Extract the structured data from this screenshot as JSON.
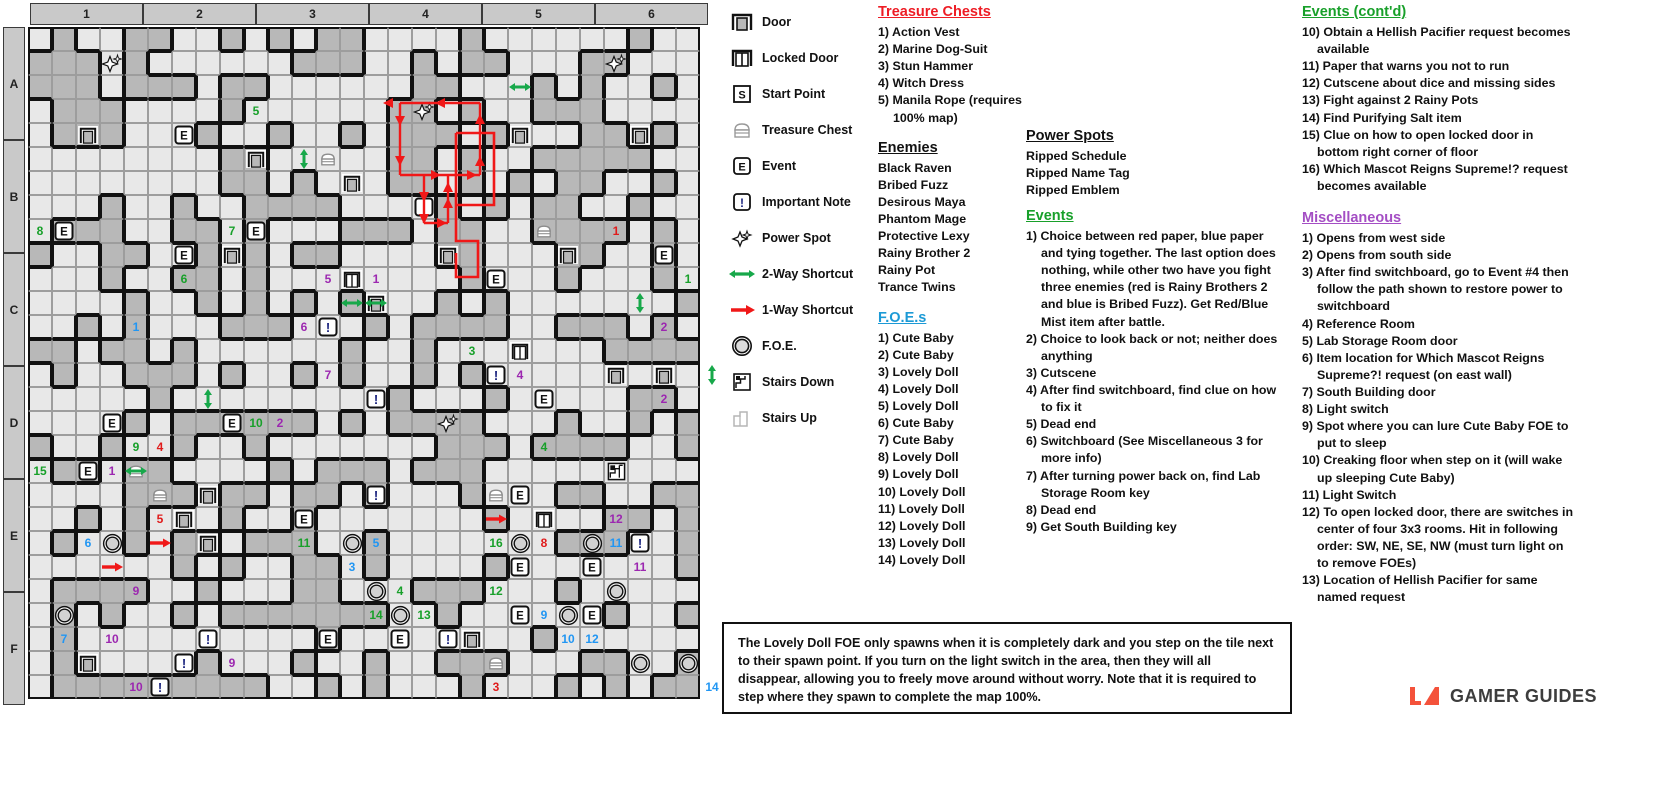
{
  "map": {
    "column_headers": [
      "1",
      "2",
      "3",
      "4",
      "5",
      "6"
    ],
    "row_headers": [
      "A",
      "B",
      "C",
      "D",
      "E",
      "F"
    ]
  },
  "legend": {
    "items": [
      {
        "icon": "door-icon",
        "label": "Door"
      },
      {
        "icon": "locked-door-icon",
        "label": "Locked Door"
      },
      {
        "icon": "start-point-icon",
        "label": "Start Point"
      },
      {
        "icon": "treasure-chest-icon",
        "label": "Treasure Chest"
      },
      {
        "icon": "event-icon",
        "label": "Event"
      },
      {
        "icon": "important-note-icon",
        "label": "Important Note"
      },
      {
        "icon": "power-spot-icon",
        "label": "Power Spot"
      },
      {
        "icon": "two-way-shortcut-icon",
        "label": "2-Way Shortcut"
      },
      {
        "icon": "one-way-shortcut-icon",
        "label": "1-Way Shortcut"
      },
      {
        "icon": "foe-icon",
        "label": "F.O.E."
      },
      {
        "icon": "stairs-down-icon",
        "label": "Stairs Down"
      },
      {
        "icon": "stairs-up-icon",
        "label": "Stairs Up"
      }
    ]
  },
  "treasure_chests": {
    "title": "Treasure Chests",
    "color": "#ee1c24",
    "items": [
      "1) Action Vest",
      "2) Marine Dog-Suit",
      "3) Stun Hammer",
      "4) Witch Dress",
      "5) Manila Rope (requires 100% map)"
    ]
  },
  "enemies": {
    "title": "Enemies",
    "color": "#111111",
    "items": [
      "Black Raven",
      "Bribed Fuzz",
      "Desirous Maya",
      "Phantom Mage",
      "Protective Lexy",
      "Rainy Brother 2",
      "Rainy Pot",
      "Trance Twins"
    ]
  },
  "foes": {
    "title": "F.O.E.s",
    "color": "#1c9ad6",
    "items": [
      "1) Cute Baby",
      "2) Cute Baby",
      "3) Lovely Doll",
      "4) Lovely Doll",
      "5) Lovely Doll",
      "6) Cute Baby",
      "7) Cute Baby",
      "8) Lovely Doll",
      "9) Lovely Doll",
      "10) Lovely Doll",
      "11) Lovely Doll",
      "12) Lovely Doll",
      "13) Lovely Doll",
      "14) Lovely Doll"
    ]
  },
  "power_spots": {
    "title": "Power Spots",
    "color": "#111111",
    "items": [
      "Ripped Schedule",
      "Ripped Name Tag",
      "Ripped Emblem"
    ]
  },
  "events": {
    "title": "Events",
    "color": "#18a02a",
    "items": [
      "1) Choice between red paper, blue paper and tying together. The last option does nothing, while other two have you fight three enemies (red is Rainy Brothers 2 and blue is Bribed Fuzz). Get Red/Blue Mist item after battle.",
      "2) Choice to look back or not; neither does anything",
      "3) Cutscene",
      "4) After find switchboard, find clue on how to fix it",
      "5) Dead end",
      "6) Switchboard (See Miscellaneous 3 for more info)",
      "7) After turning power back on, find Lab Storage Room key",
      "8) Dead end",
      "9) Get South Building key"
    ]
  },
  "events_cont": {
    "title": "Events (cont'd)",
    "color": "#18a02a",
    "items": [
      "10) Obtain a Hellish Pacifier request becomes available",
      "11) Paper that warns you not to run",
      "12) Cutscene about dice and missing sides",
      "13) Fight against 2 Rainy Pots",
      "14) Find Purifying Salt item",
      "15) Clue on how to open locked door in bottom right corner of floor",
      "16) Which Mascot Reigns Supreme!? request becomes available"
    ]
  },
  "miscellaneous": {
    "title": "Miscellaneous",
    "color": "#a44ec4",
    "items": [
      "1) Opens from west side",
      "2) Opens from south side",
      "3) After find switchboard, go to Event #4 then follow the path shown to restore power to switchboard",
      "4) Reference Room",
      "5) Lab Storage Room door",
      "6) Item location for Which Mascot Reigns Supreme?! request (on east wall)",
      "7) South Building door",
      "8) Light switch",
      "9) Spot where you can lure Cute Baby FOE to put to sleep",
      "10) Creaking floor when step on it (will wake up sleeping Cute Baby)",
      "11) Light Switch",
      "12) To open locked door, there are switches in center of four 3x3 rooms. Hit in following order: SW, NE, SE, NW (must turn light on to remove FOEs)",
      "13) Location of Hellish Pacifier for same named request"
    ]
  },
  "note": {
    "text": "The Lovely Doll FOE only spawns when it is completely dark and you step on the tile next to their spawn point. If you turn on the light switch in the area, then they will all disappear, allowing you to freely move around without worry. Note that it is required to step where they spawn to complete the map 100%."
  },
  "logo": {
    "text": "GAMER GUIDES",
    "accent": "#f4523b"
  },
  "watermark": {
    "text": "GAMER GUIDES"
  },
  "chart_data": {
    "type": "table",
    "title": "Dungeon Floor Map",
    "markers": {
      "chest_numbers": [
        8,
        7,
        6,
        5,
        9,
        15
      ],
      "event_numbers": [
        1,
        2,
        3,
        4,
        5,
        1,
        11,
        3,
        9,
        10,
        12,
        13,
        14,
        15,
        16,
        8,
        6,
        7,
        2
      ],
      "foe_numbers": [
        1,
        2,
        3,
        4,
        5,
        6,
        7,
        8,
        9,
        10,
        11,
        12,
        13,
        14
      ],
      "misc_numbers": [
        1,
        2,
        3,
        4,
        5,
        6,
        7,
        8,
        9,
        10,
        11,
        12,
        13
      ]
    }
  }
}
